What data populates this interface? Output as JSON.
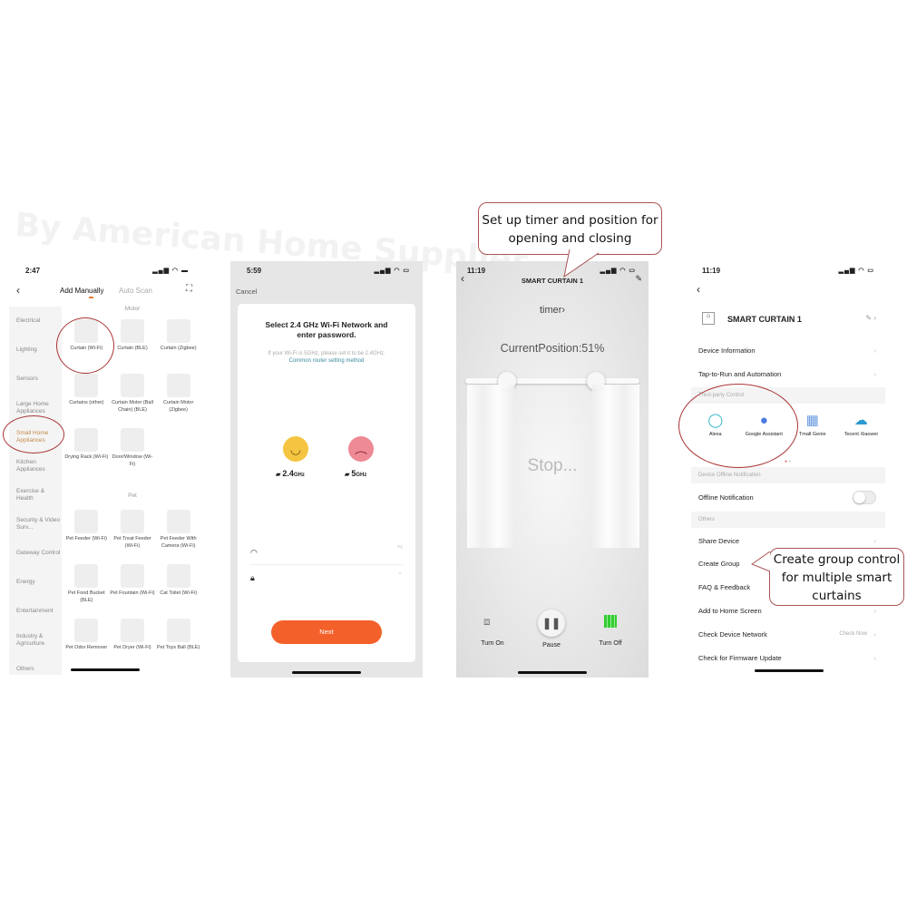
{
  "watermark": "By American Home Supplier",
  "panel1": {
    "time": "2:47",
    "tabs": [
      "Add Manually",
      "Auto Scan"
    ],
    "sidebar": [
      "Electrical",
      "Lighting",
      "Sensors",
      "Large Home Appliances",
      "Small Home Appliances",
      "Kitchen Appliances",
      "Exercise & Health",
      "Security & Video Surv...",
      "Gateway Control",
      "Energy",
      "Entertainment",
      "Industry & Agriculture",
      "Others"
    ],
    "selected_category": "Small Home Appliances",
    "sections": [
      {
        "title": "Motor",
        "items": [
          "Curtain (Wi-Fi)",
          "Curtain (BLE)",
          "Curtain (Zigbee)",
          "Curtains (other)",
          "Curtain Motor (Ball Chain) (BLE)",
          "Curtain Motor (Zigbee)",
          "Drying Rack (Wi-Fi)",
          "Door/Window (Wi-Fi)"
        ]
      },
      {
        "title": "Pet",
        "items": [
          "Pet Feeder (Wi-Fi)",
          "Pet Treat Feeder (Wi-Fi)",
          "Pet Feeder With Camera (Wi-Fi)",
          "Pet Food Bucket (BLE)",
          "Pet Fountain (Wi-Fi)",
          "Cat Toilet (Wi-Fi)",
          "Pet Odor Remover",
          "Pet Dryer (Wi-Fi)",
          "Pet Toys Ball (BLE)"
        ]
      }
    ]
  },
  "panel2": {
    "time": "5:59",
    "cancel": "Cancel",
    "title": "Select 2.4 GHz Wi-Fi Network and enter password.",
    "hint": "If your Wi-Fi is 5GHz, please set it to be 2.4GHz.",
    "link": "Common router setting method",
    "ok_band": "2.4",
    "bad_band": "5",
    "unit": "GHz",
    "next": "Next",
    "accent": "#f4602a"
  },
  "panel3": {
    "time": "11:19",
    "title": "SMART CURTAIN 1",
    "timer": "timer",
    "position_label": "CurrentPosition:51%",
    "position_percent": 51,
    "status": "Stop...",
    "controls": [
      "Turn On",
      "Pause",
      "Turn Off"
    ]
  },
  "panel4": {
    "time": "11:19",
    "device": "SMART CURTAIN 1",
    "rows1": [
      "Device Information",
      "Tap-to-Run and Automation"
    ],
    "third_party_header": "Third-party Control",
    "third_party": [
      "Alexa",
      "Google Assistant",
      "Tmall Genie",
      "Tecent Xiaowei"
    ],
    "offline_header": "Device Offline Notification",
    "offline": "Offline Notification",
    "offline_enabled": false,
    "others_header": "Others",
    "rows2": [
      "Share Device",
      "Create Group",
      "FAQ & Feedback",
      "Add to Home Screen",
      "Check Device Network",
      "Check for Firmware Update"
    ],
    "check_now": "Check Now"
  },
  "callouts": {
    "timer": "Set up timer and position for opening and closing",
    "group": "Create group control for multiple smart curtains"
  }
}
